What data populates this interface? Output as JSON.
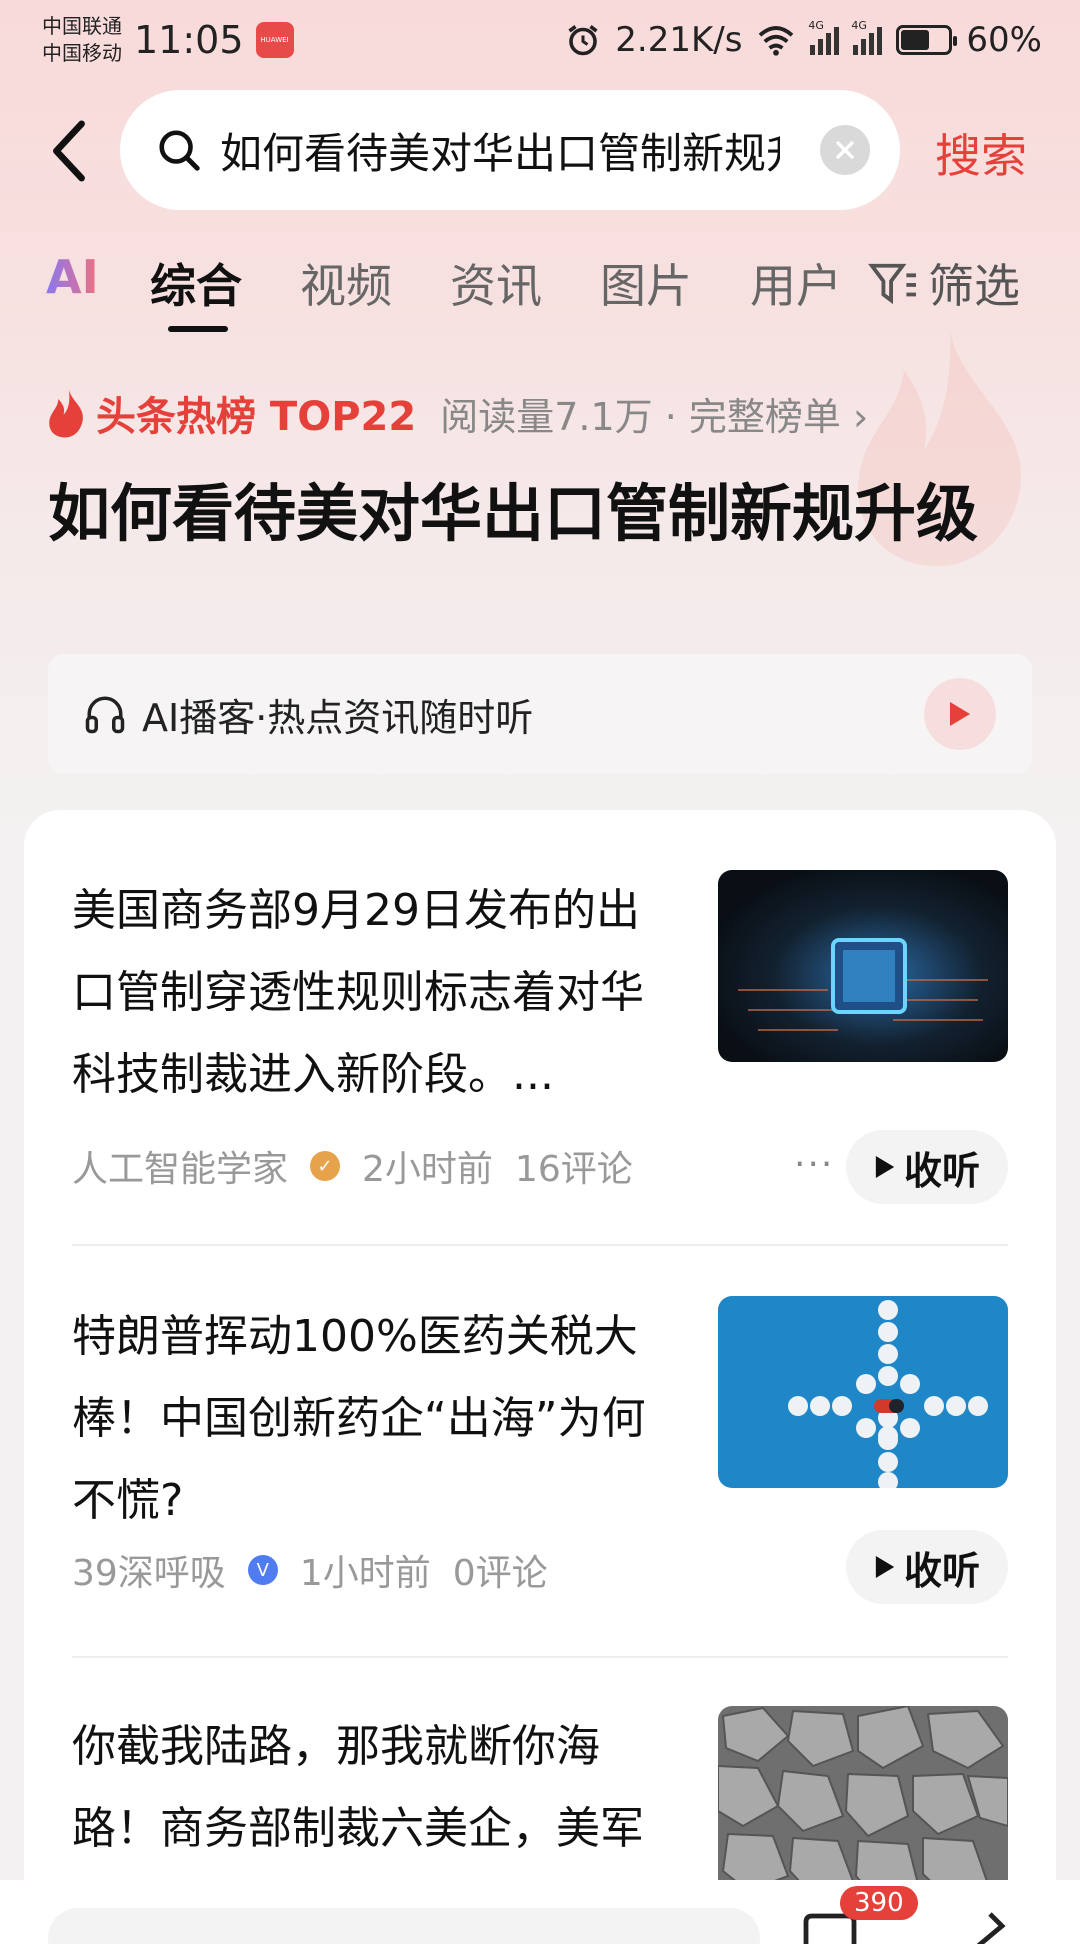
{
  "status_bar": {
    "carrier_1": "中国联通",
    "carrier_2": "中国移动",
    "time": "11:05",
    "speed": "2.21K/s",
    "battery": "60%",
    "battery_level": 0.6
  },
  "search": {
    "query": "如何看待美对华出口管制新规升级",
    "submit_label": "搜索"
  },
  "tabs": {
    "ai": "AI",
    "items": [
      "综合",
      "视频",
      "资讯",
      "图片",
      "用户"
    ],
    "filter_label": "筛选"
  },
  "hot": {
    "label": "头条热榜 TOP22",
    "meta": "阅读量7.1万 · 完整榜单 ›"
  },
  "headline": "如何看待美对华出口管制新规升级",
  "podcast": {
    "label": "AI播客·热点资讯随时听"
  },
  "results": [
    {
      "title": "美国商务部9月29日发布的出口管制穿透性规则标志着对华科技制裁进入新阶段。...",
      "author": "人工智能学家",
      "time": "2小时前",
      "comments": "16评论",
      "listen": "收听",
      "more": "···"
    },
    {
      "title": "特朗普挥动100%医药关税大棒！中国创新药企“出海”为何不慌?",
      "author": "39深呼吸",
      "time": "1小时前",
      "comments": "0评论",
      "listen": "收听"
    },
    {
      "title": "你截我陆路，那我就断你海路！商务部制裁六美企，美军被打中七寸"
    }
  ],
  "bottom": {
    "comment_count": "390"
  },
  "colors": {
    "accent": "#e5403a",
    "hero_bg": "#f8dada"
  }
}
